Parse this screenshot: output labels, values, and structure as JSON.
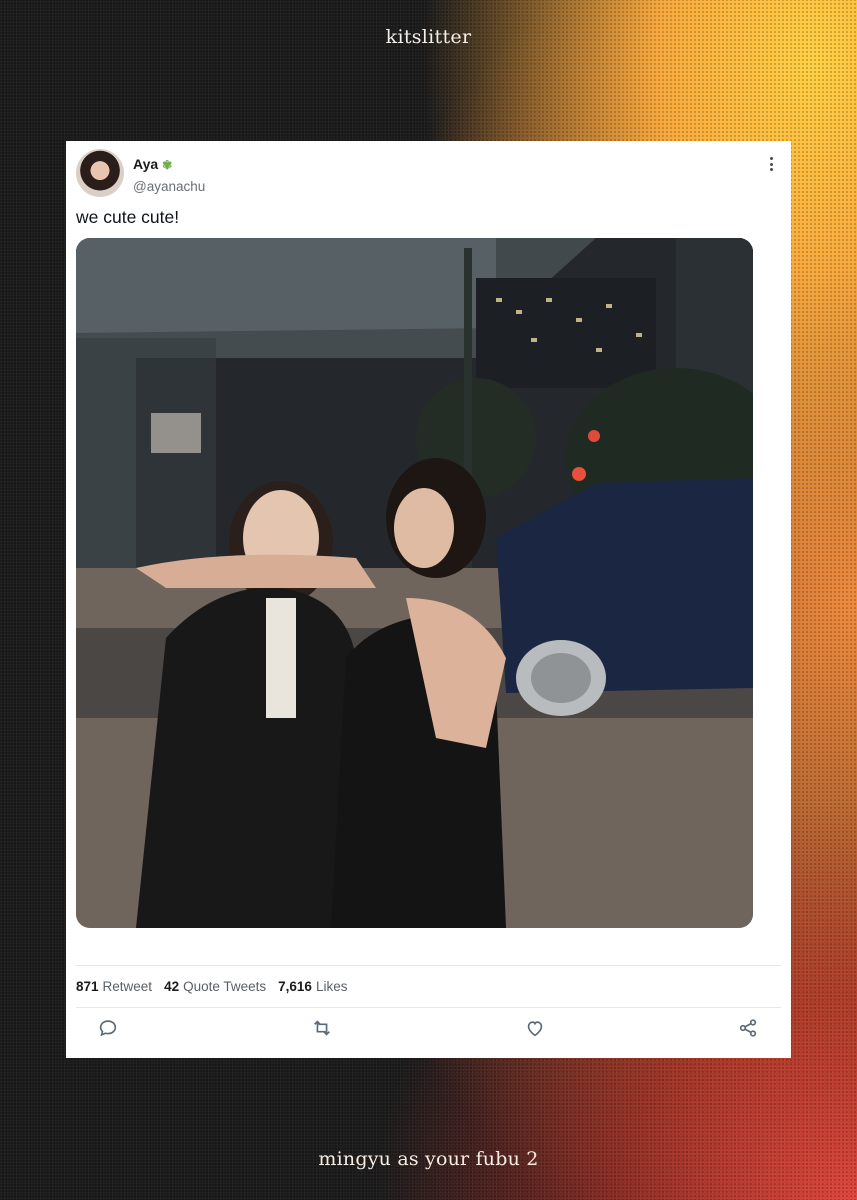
{
  "page": {
    "header_text": "kitslitter",
    "footer_text": "mingyu as your fubu 2"
  },
  "tweet": {
    "display_name": "Aya",
    "name_badge_icon": "sparkle-flower-icon",
    "handle": "@ayanachu",
    "text": "we cute cute!",
    "media": "photo",
    "stats": {
      "retweets_count": "871",
      "retweets_label": "Retweet",
      "quotes_count": "42",
      "quotes_label": "Quote Tweets",
      "likes_count": "7,616",
      "likes_label": "Likes"
    },
    "actions": [
      "reply-icon",
      "retweet-icon",
      "like-icon",
      "share-icon"
    ]
  },
  "colors": {
    "card_bg": "#ffffff",
    "text_primary": "#0f1419",
    "text_secondary": "#6b6f74",
    "icon": "#5b6a78"
  }
}
